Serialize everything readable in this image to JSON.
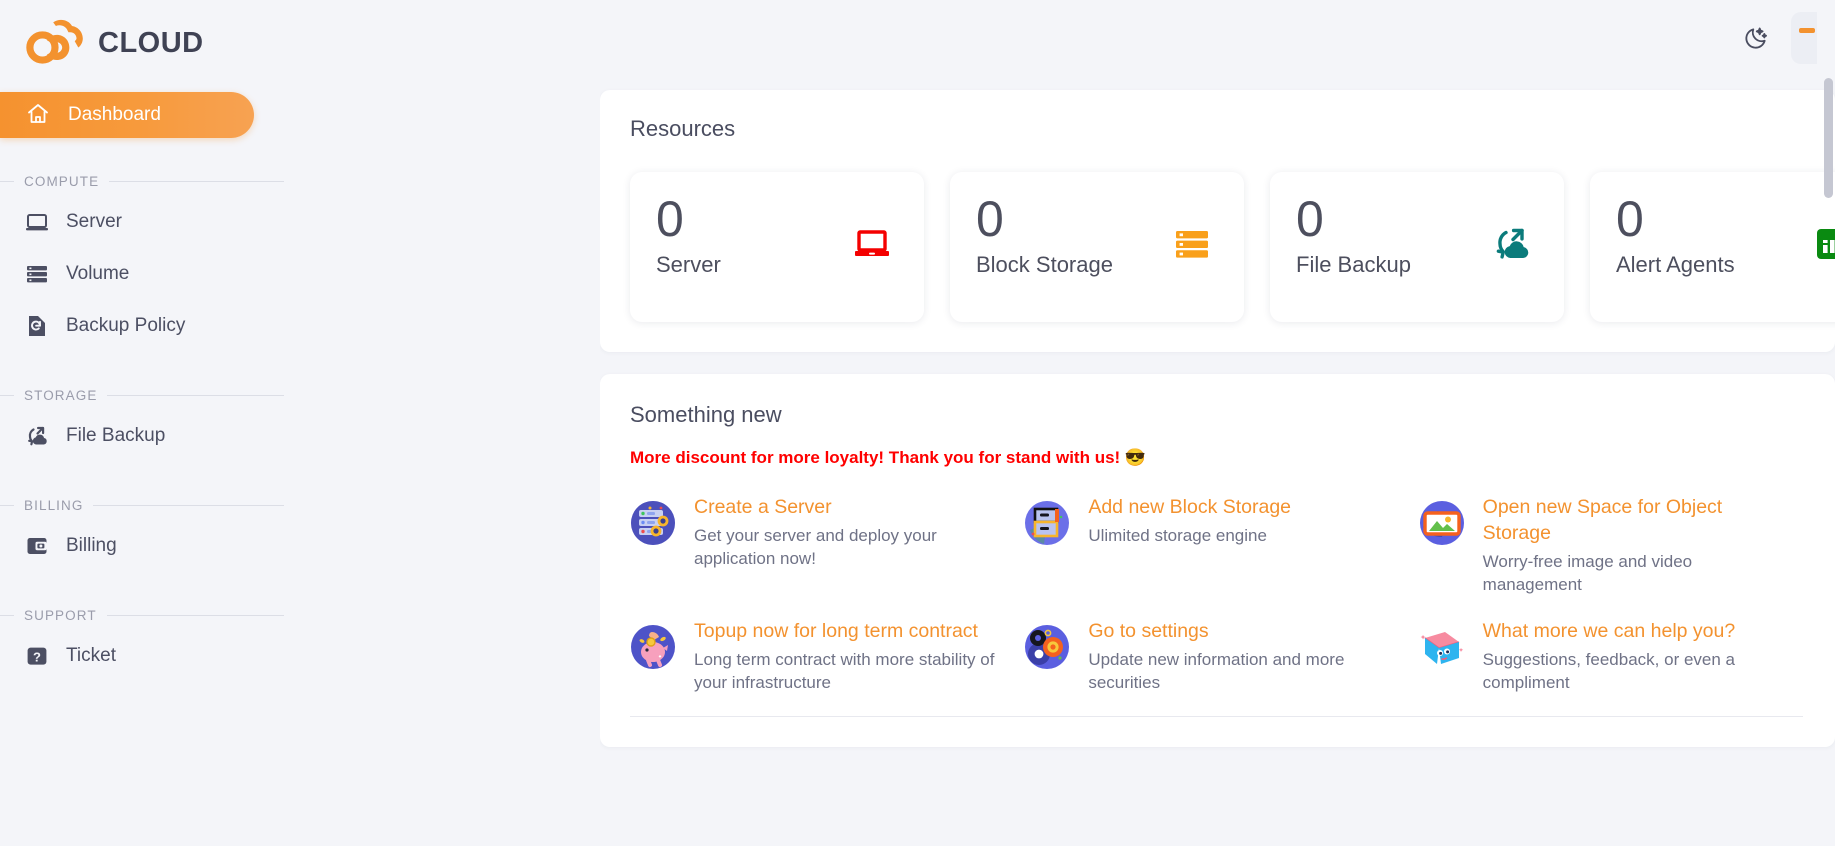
{
  "brand": {
    "name": "CLOUD",
    "logo_icon": "cloud-infinity-logo"
  },
  "topbar": {
    "theme_toggle_icon": "moon-icon",
    "profile_chip": "profile-avatar-chip"
  },
  "sidebar": {
    "active_item": {
      "label": "Dashboard",
      "icon": "home-icon"
    },
    "sections": [
      {
        "title": "COMPUTE",
        "items": [
          {
            "label": "Server",
            "icon": "laptop-icon"
          },
          {
            "label": "Volume",
            "icon": "server-stack-icon"
          },
          {
            "label": "Backup Policy",
            "icon": "file-restore-icon"
          }
        ]
      },
      {
        "title": "STORAGE",
        "items": [
          {
            "label": "File Backup",
            "icon": "cloud-sync-icon"
          }
        ]
      },
      {
        "title": "BILLING",
        "items": [
          {
            "label": "Billing",
            "icon": "wallet-icon"
          }
        ]
      },
      {
        "title": "SUPPORT",
        "items": [
          {
            "label": "Ticket",
            "icon": "question-box-icon"
          }
        ]
      }
    ]
  },
  "resources": {
    "title": "Resources",
    "cards": [
      {
        "count": "0",
        "name": "Server",
        "icon": "laptop-icon",
        "color": "#f40000"
      },
      {
        "count": "0",
        "name": "Block Storage",
        "icon": "storage-bars-icon",
        "color": "#f9a01b"
      },
      {
        "count": "0",
        "name": "File Backup",
        "icon": "cloud-sync-icon",
        "color": "#0b7b7b"
      },
      {
        "count": "0",
        "name": "Alert Agents",
        "icon": "chart-bars-icon",
        "color": "#0a8a11"
      }
    ]
  },
  "something_new": {
    "title": "Something new",
    "announcement": "More discount for more loyalty! Thank you for stand with us! 😎",
    "announcement_color": "#ff0000",
    "items": [
      {
        "title": "Create a Server",
        "desc": "Get your server and deploy your application now!",
        "icon": "server-rack-illustration"
      },
      {
        "title": "Add new Block Storage",
        "desc": "Ulimited storage engine",
        "icon": "block-storage-illustration"
      },
      {
        "title": "Open new Space for Object Storage",
        "desc": "Worry-free image and video management",
        "icon": "photo-frame-illustration"
      },
      {
        "title": "Topup now for long term contract",
        "desc": "Long term contract with more stability of your infrastructure",
        "icon": "piggy-bank-illustration"
      },
      {
        "title": "Go to settings",
        "desc": "Update new information and more securities",
        "icon": "gears-illustration"
      },
      {
        "title": "What more we can help you?",
        "desc": "Suggestions, feedback, or even a compliment",
        "icon": "mailbox-illustration"
      }
    ]
  },
  "theme": {
    "accent": "#f3922f",
    "text_dark": "#4a4d60",
    "muted": "#9a9cab"
  }
}
